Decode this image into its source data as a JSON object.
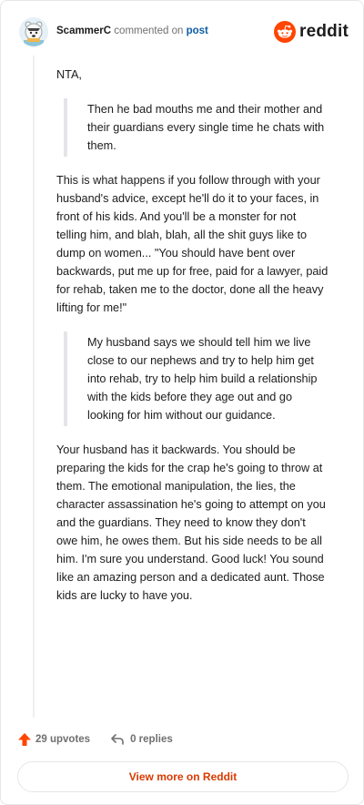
{
  "header": {
    "username": "ScammerC",
    "action": "commented on",
    "post_link": "post",
    "brand": "reddit"
  },
  "comment": {
    "opening": "NTA,",
    "quote1": "Then he bad mouths me and their mother and their guardians every single time he chats with them.",
    "para1": "This is what happens if you follow through with your husband's advice, except he'll do it to your faces, in front of his kids. And you'll be a monster for not telling him, and blah, blah, all the shit guys like to dump on women... \"You should have bent over backwards, put me up for free, paid for a lawyer, paid for rehab, taken me to the doctor, done all the heavy lifting for me!\"",
    "quote2": "My husband says we should tell him we live close to our nephews and try to help him get into rehab, try to help him build a relationship with the kids before they age out and go looking for him without our guidance.",
    "para2": "Your husband has it backwards. You should be preparing the kids for the crap he's going to throw at them. The emotional manipulation, the lies, the character assassination he's going to attempt on you and the guardians. They need to know they don't owe him, he owes them. But his side needs to be all him. I'm sure you understand. Good luck! You sound like an amazing person and a dedicated aunt. Those kids are lucky to have you."
  },
  "footer": {
    "upvotes": "29 upvotes",
    "replies": "0 replies",
    "view_more": "View more on Reddit"
  },
  "colors": {
    "accent": "#ff4500",
    "link": "#0e5ea5",
    "view_more": "#d93a00"
  },
  "icons": [
    "avatar",
    "reddit-snoo-icon",
    "upvote-arrow-icon",
    "reply-icon"
  ]
}
